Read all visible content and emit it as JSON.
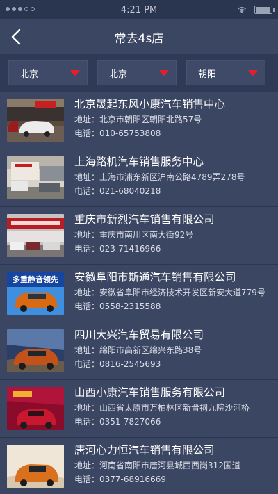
{
  "status_bar": {
    "time": "4:21 PM"
  },
  "nav": {
    "title": "常去4s店"
  },
  "filters": [
    {
      "label": "北京"
    },
    {
      "label": "北京"
    },
    {
      "label": "朝阳"
    }
  ],
  "labels": {
    "address": "地址：",
    "phone": "电话："
  },
  "dealers": [
    {
      "name": "北京晟起东风小康汽车销售中心",
      "address": "北京市朝阳区朝阳北路57号",
      "phone": "010-65753808"
    },
    {
      "name": "上海路机汽车销售服务中心",
      "address": "上海市浦东新区沪南公路4789弄278号",
      "phone": "021-68040218"
    },
    {
      "name": "重庆市新烈汽车销售有限公司",
      "address": "重庆市南川区南大街92号",
      "phone": "023-71416966"
    },
    {
      "name": "安徽阜阳市斯通汽车销售有限公司",
      "address": "安徽省阜阳市经济技术开发区新安大道779号",
      "phone": "0558-2315588",
      "thumb_text": "多重静音领先"
    },
    {
      "name": "四川大兴汽车贸易有限公司",
      "address": "绵阳市高新区绵兴东路38号",
      "phone": "0816-2545693"
    },
    {
      "name": "山西小康汽车销售服务有限公司",
      "address": "山西省太原市万柏林区新晋祠九院沙河桥",
      "phone": "0351-7827066"
    },
    {
      "name": "唐河心力恒汽车销售有限公司",
      "address": "河南省南阳市唐河县城西西岗312国道",
      "phone": "0377-68916669"
    }
  ],
  "colors": {
    "background": "#3b4662",
    "filter_bar": "#2f3a56",
    "arrow": "#e0202e"
  }
}
